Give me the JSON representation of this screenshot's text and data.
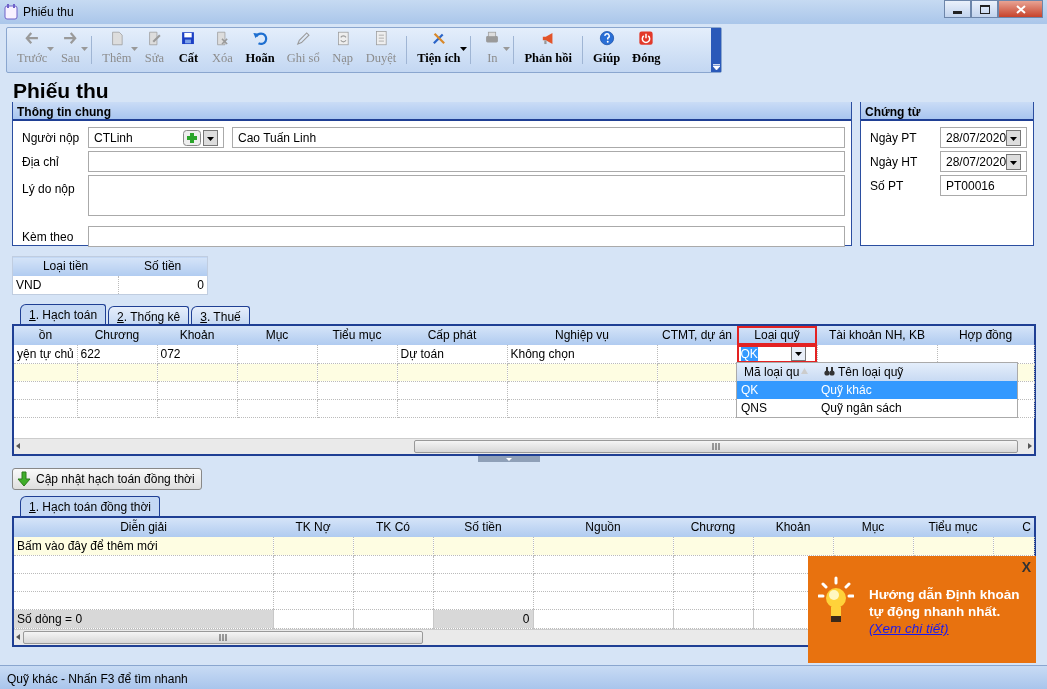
{
  "window": {
    "title": "Phiếu thu"
  },
  "toolbar": [
    {
      "label": "Trước",
      "disabled": true,
      "dropdown": true,
      "separator_before": false
    },
    {
      "label": "Sau",
      "disabled": true,
      "dropdown": true,
      "separator_before": false
    },
    {
      "label": "Thêm",
      "disabled": true,
      "dropdown": true,
      "separator_before": true
    },
    {
      "label": "Sửa",
      "disabled": true,
      "dropdown": false,
      "separator_before": false
    },
    {
      "label": "Cất",
      "disabled": false,
      "dropdown": false,
      "separator_before": false
    },
    {
      "label": "Xóa",
      "disabled": true,
      "dropdown": false,
      "separator_before": false
    },
    {
      "label": "Hoãn",
      "disabled": false,
      "dropdown": false,
      "separator_before": false
    },
    {
      "label": "Ghi sổ",
      "disabled": true,
      "dropdown": false,
      "separator_before": false
    },
    {
      "label": "Nạp",
      "disabled": true,
      "dropdown": false,
      "separator_before": false
    },
    {
      "label": "Duyệt",
      "disabled": true,
      "dropdown": false,
      "separator_before": false
    },
    {
      "label": "Tiện ích",
      "disabled": false,
      "dropdown": true,
      "separator_before": true
    },
    {
      "label": "In",
      "disabled": true,
      "dropdown": true,
      "separator_before": true
    },
    {
      "label": "Phản hồi",
      "disabled": false,
      "dropdown": false,
      "separator_before": true
    },
    {
      "label": "Giúp",
      "disabled": false,
      "dropdown": false,
      "separator_before": true
    },
    {
      "label": "Đóng",
      "disabled": false,
      "dropdown": false,
      "separator_before": false
    }
  ],
  "heading": "Phiếu thu",
  "general_info": {
    "title": "Thông tin chung",
    "fields": [
      {
        "label": "Người nộp",
        "kind": "lookup",
        "code": "CTLinh",
        "value": "Cao Tuấn Linh"
      },
      {
        "label": "Địa chỉ",
        "kind": "text"
      },
      {
        "label": "Lý do nộp",
        "kind": "textarea"
      },
      {
        "label": "Kèm theo",
        "kind": "text"
      }
    ]
  },
  "voucher": {
    "title": "Chứng từ",
    "fields": [
      {
        "label": "Ngày PT",
        "kind": "date",
        "value": "28/07/2020"
      },
      {
        "label": "Ngày HT",
        "kind": "date",
        "value": "28/07/2020"
      },
      {
        "label": "Số PT",
        "kind": "text",
        "value": "PT00016"
      }
    ]
  },
  "currency_table": {
    "columns": [
      "Loại tiền",
      "Số tiền"
    ],
    "rows": [
      [
        "VND",
        "0"
      ]
    ]
  },
  "detail_tabs": [
    {
      "label": "1. Hạch toán",
      "selected": true
    },
    {
      "label": "2. Thống kê",
      "selected": false
    },
    {
      "label": "3. Thuế",
      "selected": false
    }
  ],
  "accounting_grid": {
    "columns": [
      {
        "label": "ồn",
        "highlighted": false
      },
      {
        "label": "Chương",
        "highlighted": false
      },
      {
        "label": "Khoản",
        "highlighted": false
      },
      {
        "label": "Mục",
        "highlighted": false
      },
      {
        "label": "Tiểu mục",
        "highlighted": false
      },
      {
        "label": "Cấp phát",
        "highlighted": false
      },
      {
        "label": "Nghiệp vụ",
        "highlighted": false
      },
      {
        "label": "CTMT, dự án",
        "highlighted": false
      },
      {
        "label": "Loại quỹ",
        "highlighted": true
      },
      {
        "label": "Tài khoản NH, KB",
        "highlighted": false
      },
      {
        "label": "Hợp đồng",
        "highlighted": false
      }
    ],
    "rows": [
      {
        "kind": "data",
        "cells": [
          "yện tự chủ",
          "622",
          "072",
          null,
          null,
          "Dự toán",
          "Không chọn",
          null,
          "QK",
          null,
          null
        ]
      },
      {
        "kind": "new"
      },
      {
        "kind": "blank"
      },
      {
        "kind": "blank"
      }
    ],
    "dropdown": {
      "columns": [
        "Mã loại qu",
        "Tên loại quỹ"
      ],
      "rows": [
        {
          "cells": [
            "QK",
            "Quỹ khác"
          ],
          "selected": true
        },
        {
          "cells": [
            "QNS",
            "Quỹ ngân sách"
          ],
          "selected": false
        }
      ]
    }
  },
  "update_button": {
    "label": "Cập nhật hạch toán đồng thời"
  },
  "sub_tabs": [
    {
      "label": "1. Hạch toán đồng thời",
      "selected": true
    }
  ],
  "concurrent_grid": {
    "columns": [
      "Diễn giải",
      "TK Nợ",
      "TK Có",
      "Số tiền",
      "Nguồn",
      "Chương",
      "Khoản",
      "Mục",
      "Tiểu mục",
      "C"
    ],
    "rows": [
      {
        "kind": "new",
        "cells": [
          "Bấm vào đây để thêm mới"
        ]
      },
      {
        "kind": "blank"
      },
      {
        "kind": "blank"
      },
      {
        "kind": "blank"
      }
    ],
    "footer": {
      "row_count": "Số dòng = 0",
      "amount_total": "0"
    }
  },
  "tip": {
    "text": "Hướng dẫn Định khoản tự động nhanh nhất.",
    "link": "(Xem chi tiết)",
    "close": "X"
  },
  "status_bar": "Quỹ khác - Nhấn F3 để tìm nhanh"
}
